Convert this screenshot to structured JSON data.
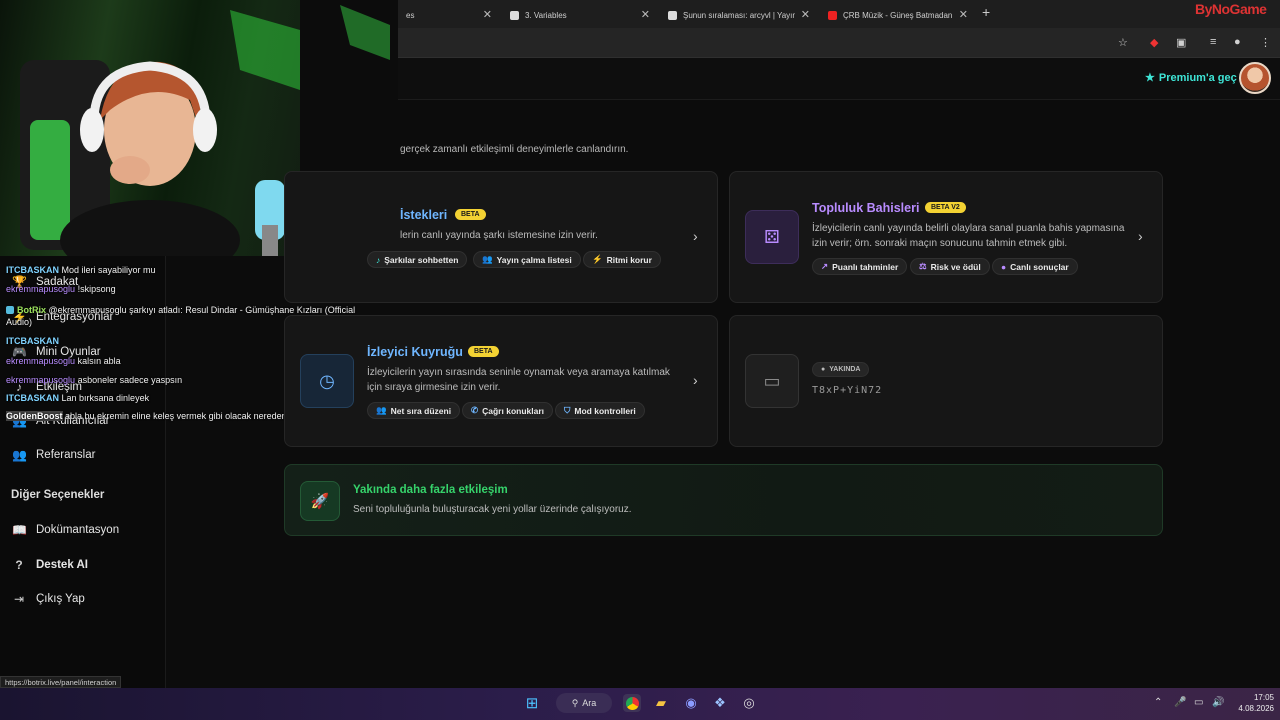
{
  "browser": {
    "tabs": [
      {
        "label": "es",
        "icon": "page-icon"
      },
      {
        "label": "3. Variables",
        "icon": "notion-icon"
      },
      {
        "label": "Şunun sıralaması: arcyvl | Yayını",
        "icon": "notion-icon"
      },
      {
        "label": "ÇRB Müzik - Güneş Batmadan",
        "icon": "youtube-icon"
      }
    ],
    "new_tab": "+",
    "brand": "ByNoGame"
  },
  "header": {
    "premium_label": "Premium'a geç"
  },
  "sidebar": {
    "items": [
      {
        "label": "Sadakat",
        "icon": "trophy-icon"
      },
      {
        "label": "Entegrasyonlar",
        "icon": "plug-icon"
      },
      {
        "label": "Mini Oyunlar",
        "icon": "gamepad-icon"
      },
      {
        "label": "Etkileşim",
        "icon": "music-icon"
      },
      {
        "label": "Alt Kullanıcılar",
        "icon": "users-icon"
      },
      {
        "label": "Referanslar",
        "icon": "users-icon"
      }
    ],
    "other_heading": "Diğer Seçenekler",
    "other_items": [
      {
        "label": "Dokümantasyon",
        "icon": "book-icon"
      },
      {
        "label": "Destek AI",
        "icon": "question-icon"
      },
      {
        "label": "Çıkış Yap",
        "icon": "logout-icon"
      }
    ]
  },
  "chat": [
    {
      "user": "ITCBASKAN",
      "text": "Mod ileri sayabiliyor mu"
    },
    {
      "user": "ekremmapusoglu",
      "text": "!skipsong"
    },
    {
      "user": "BotRix",
      "text": "@ekremmapusoglu şarkıyı atladı: Resul Dindar - Gümüşhane Kızları (Official Audio)"
    },
    {
      "user": "ITCBASKAN",
      "text": ""
    },
    {
      "user": "ekremmapusoglu",
      "text": "kalsın abla"
    },
    {
      "user": "ekremmapusoglu",
      "text": "asboneler sadece yaspsın"
    },
    {
      "user": "ITCBASKAN",
      "text": "Lan bırksana dinleyek"
    },
    {
      "user": "GoldenBoost",
      "text": "abla bu ekremin eline keleş vermek gibi olacak nereden çıktı"
    }
  ],
  "content": {
    "subtitle": "gerçek zamanlı etkileşimli deneyimlerle canlandırın.",
    "cards": [
      {
        "title": "İstekleri",
        "badge": "BETA",
        "desc": "lerin canlı yayında şarkı istemesine izin verir.",
        "chips": [
          "Şarkılar sohbetten",
          "Yayın çalma listesi",
          "Ritmi korur"
        ]
      },
      {
        "title": "Topluluk Bahisleri",
        "badge": "BETA V2",
        "desc": "İzleyicilerin canlı yayında belirli olaylara sanal puanla bahis yapmasına izin verir; örn. sonraki maçın sonucunu tahmin etmek gibi.",
        "chips": [
          "Puanlı tahminler",
          "Risk ve ödül",
          "Canlı sonuçlar"
        ]
      },
      {
        "title": "İzleyici Kuyruğu",
        "badge": "BETA",
        "desc": "İzleyicilerin yayın sırasında seninle oynamak veya aramaya katılmak için sıraya girmesine izin verir.",
        "chips": [
          "Net sıra düzeni",
          "Çağrı konukları",
          "Mod kontrolleri"
        ]
      },
      {
        "badge": "YAKINDA",
        "code": "T8xP+YiN72"
      }
    ],
    "banner": {
      "title": "Yakında daha fazla etkileşim",
      "desc": "Seni topluluğunla buluşturacak yeni yollar üzerinde çalışıyoruz."
    }
  },
  "status_url": "https://botrix.live/panel/interaction",
  "taskbar": {
    "search_label": "Ara",
    "time": "17:05",
    "date": "4.08.2026"
  },
  "colors": {
    "accent_teal": "#3ee5d6",
    "beta_yellow": "#f3d233",
    "title_blue": "#6fb6ff",
    "title_purple": "#b98cff",
    "banner_green": "#36d36b"
  }
}
